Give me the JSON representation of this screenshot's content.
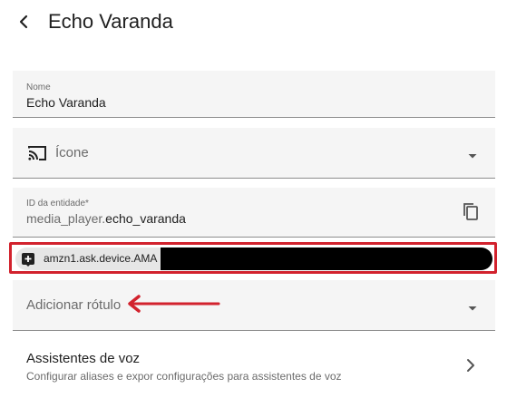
{
  "header": {
    "title": "Echo Varanda"
  },
  "name_field": {
    "label": "Nome",
    "value": "Echo Varanda"
  },
  "icon_field": {
    "placeholder": "Ícone"
  },
  "entity_field": {
    "label": "ID da entidade*",
    "prefix": "media_player.",
    "value": "echo_varanda"
  },
  "alias_chip": {
    "text": "amzn1.ask.device.AMA"
  },
  "label_field": {
    "placeholder": "Adicionar rótulo"
  },
  "assistants": {
    "title": "Assistentes de voz",
    "subtitle": "Configurar aliases e expor configurações para assistentes de voz"
  },
  "colors": {
    "highlight": "#d2222d",
    "field_bg": "#f5f5f5",
    "chip_bg": "#e6e6e6"
  },
  "icons": [
    "back-arrow",
    "cast",
    "dropdown",
    "copy",
    "alias-tag",
    "chevron-right",
    "annotation-arrow"
  ]
}
